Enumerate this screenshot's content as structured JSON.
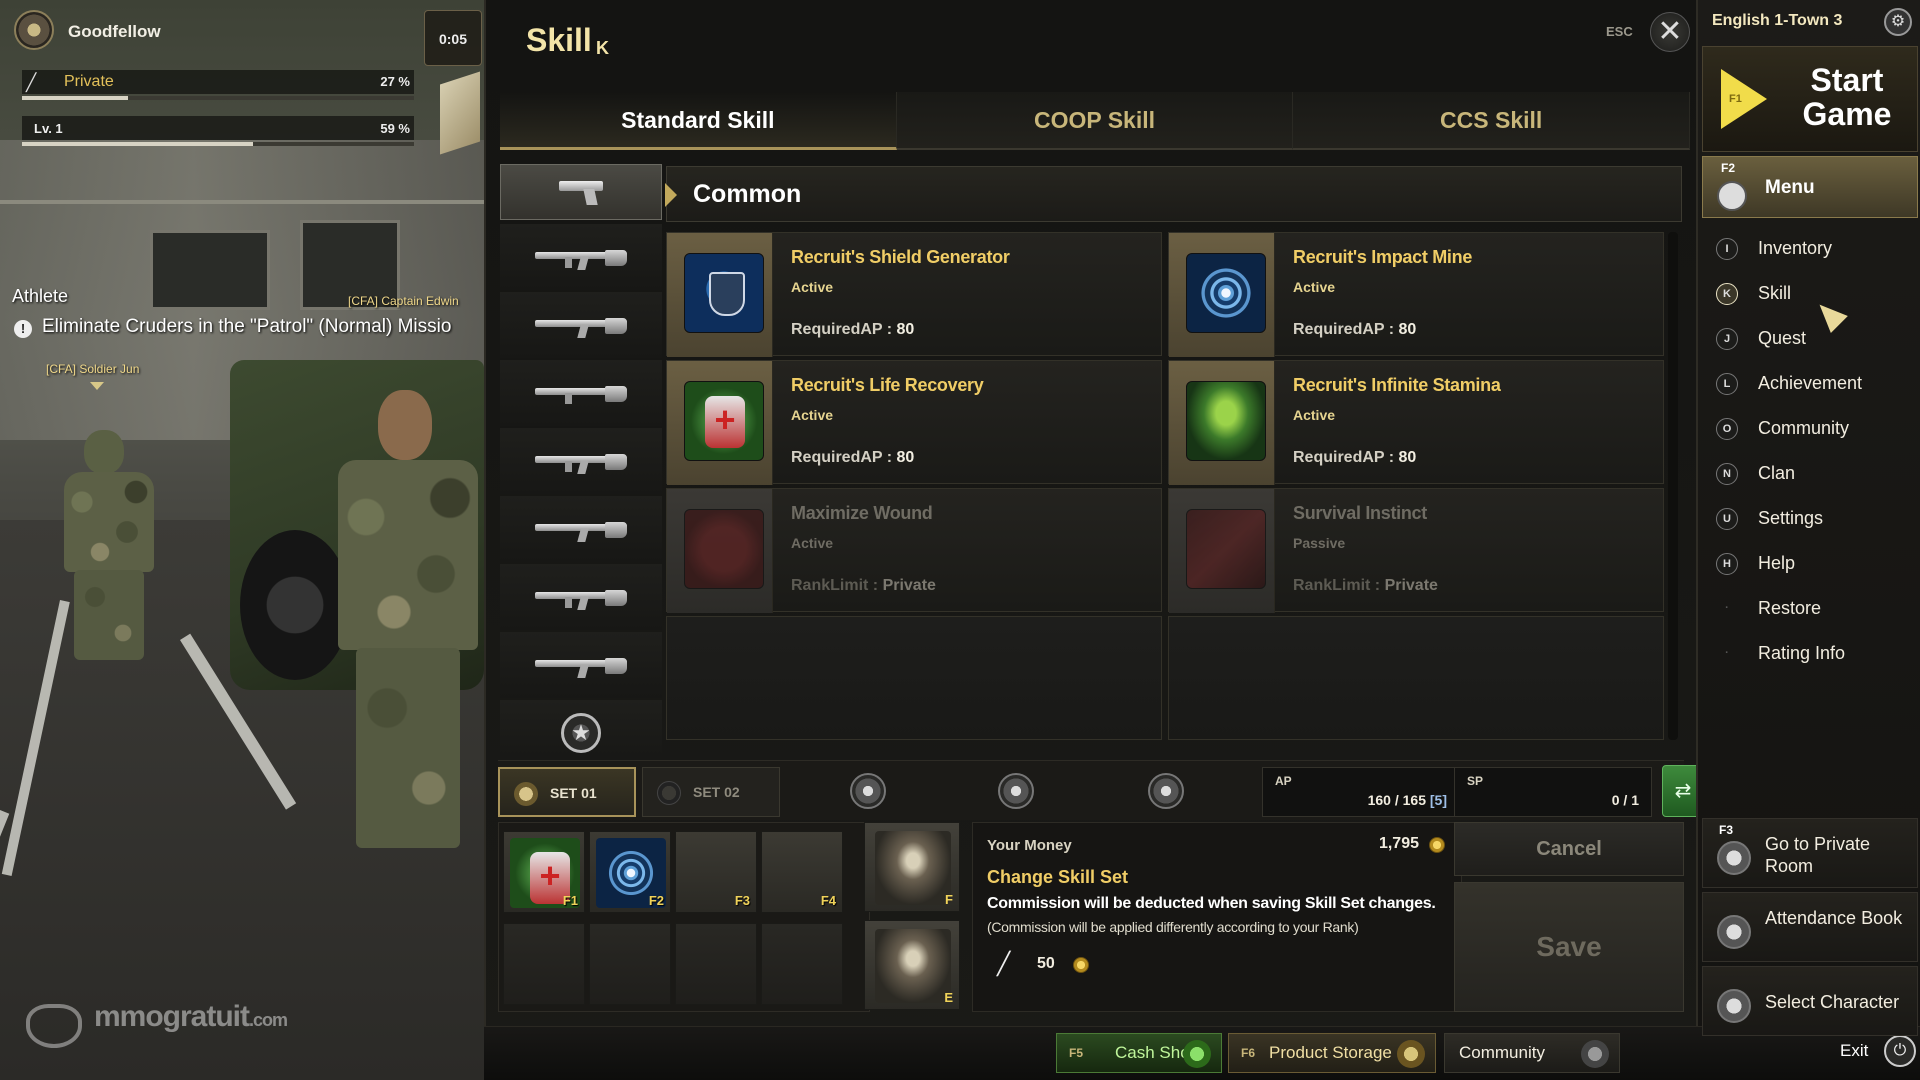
{
  "hud": {
    "player_name": "Goodfellow",
    "timer": "0:05",
    "rank": "Private",
    "rank_percent": "27 %",
    "rank_fill": 0.27,
    "level": "Lv. 1",
    "level_percent": "59 %",
    "level_fill": 0.59
  },
  "quest": {
    "category": "Athlete",
    "npc_top": "[CFA] Captain Edwin",
    "objective": "Eliminate Cruders in the \"Patrol\" (Normal) Missio",
    "npc_bottom": "[CFA] Soldier Jun"
  },
  "watermark": {
    "brand": "mmogratuit",
    "suffix": ".com"
  },
  "skill_window": {
    "title": "Skill",
    "title_key": "K",
    "esc_label": "ESC",
    "close_glyph": "✕",
    "tabs": [
      {
        "label": "Standard Skill",
        "active": true
      },
      {
        "label": "COOP Skill",
        "active": false
      },
      {
        "label": "CCS Skill",
        "active": false
      }
    ],
    "category_icons": [
      "pistol-icon",
      "assault-rifle-icon",
      "shotgun-icon",
      "smg-icon",
      "rifle-icon",
      "sniper-rifle-icon",
      "machine-gun-icon",
      "launcher-icon",
      "emblem-icon"
    ],
    "category_title": "Common",
    "skills": [
      {
        "name": "Recruit's Shield Generator",
        "type": "Active",
        "req_label": "RequiredAP : ",
        "req_value": "80",
        "icon": "shield-icon",
        "locked": false
      },
      {
        "name": "Recruit's Impact Mine",
        "type": "Active",
        "req_label": "RequiredAP : ",
        "req_value": "80",
        "icon": "mine-icon",
        "locked": false
      },
      {
        "name": "Recruit's Life Recovery",
        "type": "Active",
        "req_label": "RequiredAP : ",
        "req_value": "80",
        "icon": "medkit-icon",
        "locked": false
      },
      {
        "name": "Recruit's Infinite Stamina",
        "type": "Active",
        "req_label": "RequiredAP : ",
        "req_value": "80",
        "icon": "stamina-icon",
        "locked": false
      },
      {
        "name": "Maximize Wound",
        "type": "Active",
        "req_label": "RankLimit : ",
        "req_value": "Private",
        "icon": "wound-icon",
        "locked": true
      },
      {
        "name": "Survival Instinct",
        "type": "Passive",
        "req_label": "RankLimit : ",
        "req_value": "Private",
        "icon": "instinct-icon",
        "locked": true
      }
    ],
    "sets": [
      {
        "label": "SET 01",
        "active": true
      },
      {
        "label": "SET 02",
        "active": false
      }
    ],
    "ap": {
      "label": "AP",
      "value": "160",
      "max": "/ 165",
      "bonus": "[5]"
    },
    "sp": {
      "label": "SP",
      "value": "0",
      "max": "/ 1"
    },
    "slots": [
      {
        "key": "F1",
        "icon": "medkit-icon"
      },
      {
        "key": "F2",
        "icon": "mine-icon"
      },
      {
        "key": "F3",
        "icon": ""
      },
      {
        "key": "F4",
        "icon": ""
      }
    ],
    "special_slots": [
      {
        "key": "F",
        "icon": "soldier-portrait-icon"
      },
      {
        "key": "E",
        "icon": "soldier-portrait-icon"
      }
    ],
    "money_label": "Your Money",
    "money_value": "1,795",
    "change_title": "Change Skill Set",
    "change_note": "Commission will be deducted when saving Skill Set changes.",
    "change_subnote": "(Commission will be applied differently according to your Rank)",
    "commission_value": "50",
    "cancel_label": "Cancel",
    "save_label": "Save"
  },
  "bottom_bar": {
    "cash_key": "F5",
    "cash_label": "Cash Shop",
    "storage_key": "F6",
    "storage_label": "Product Storage",
    "community_label": "Community",
    "exit_label": "Exit"
  },
  "right_menu": {
    "server": "English 1-Town 3",
    "start_key": "F1",
    "start_label": "Start Game",
    "menu_key": "F2",
    "menu_label": "Menu",
    "items": [
      {
        "key": "I",
        "label": "Inventory"
      },
      {
        "key": "K",
        "label": "Skill"
      },
      {
        "key": "J",
        "label": "Quest"
      },
      {
        "key": "L",
        "label": "Achievement"
      },
      {
        "key": "O",
        "label": "Community"
      },
      {
        "key": "N",
        "label": "Clan"
      },
      {
        "key": "U",
        "label": "Settings"
      },
      {
        "key": "H",
        "label": "Help"
      },
      {
        "key": "·",
        "label": "Restore"
      },
      {
        "key": "·",
        "label": "Rating Info"
      }
    ],
    "private_room_key": "F3",
    "private_room_label": "Go to Private Room",
    "attendance_label": "Attendance Book",
    "select_char_label": "Select Character"
  }
}
